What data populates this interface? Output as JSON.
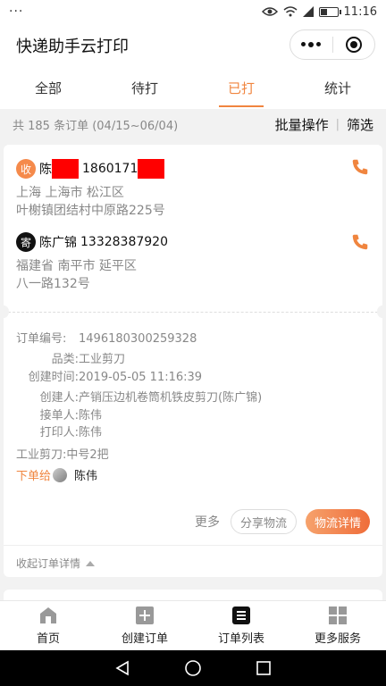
{
  "status_bar": {
    "dots": "···",
    "time": "11:16"
  },
  "header": {
    "title": "快递助手云打印"
  },
  "tabs": [
    {
      "label": "全部"
    },
    {
      "label": "待打"
    },
    {
      "label": "已打",
      "active": true
    },
    {
      "label": "统计"
    }
  ],
  "summary": {
    "count_text": "共 185 条订单 (04/15~06/04)",
    "batch_label": "批量操作",
    "divider": "|",
    "filter_label": "筛选"
  },
  "order": {
    "receiver": {
      "badge": "收",
      "name_visible": "陈",
      "phone_visible": "1860171",
      "address_line1": "上海 上海市 松江区",
      "address_line2": "叶榭镇团结村中原路225号"
    },
    "sender": {
      "badge": "寄",
      "name": "陈广锦",
      "phone": "13328387920",
      "address_line1": "福建省 南平市 延平区",
      "address_line2": "八一路132号"
    },
    "details": [
      {
        "label": "订单编号:",
        "value": "1496180300259328"
      },
      {
        "label": "品类:",
        "value": "工业剪刀"
      },
      {
        "label": "创建时间:",
        "value": "2019-05-05 11:16:39"
      },
      {
        "label": "创建人:",
        "value": "产销压边机卷筒机铁皮剪刀(陈广锦)"
      },
      {
        "label": "接单人:",
        "value": "陈伟"
      },
      {
        "label": "打印人:",
        "value": "陈伟"
      }
    ],
    "note": "工业剪刀:中号2把",
    "assign_label": "下单给",
    "assign_name": "陈伟",
    "more_label": "更多",
    "share_label": "分享物流",
    "logistics_label": "物流详情",
    "collapse_label": "收起订单详情"
  },
  "nav": [
    {
      "label": "首页",
      "icon": "home-icon"
    },
    {
      "label": "创建订单",
      "icon": "plus-square-icon"
    },
    {
      "label": "订单列表",
      "icon": "list-icon",
      "active": true
    },
    {
      "label": "更多服务",
      "icon": "grid-icon"
    }
  ],
  "colors": {
    "accent": "#f0853f",
    "redaction": "#ff0000"
  }
}
